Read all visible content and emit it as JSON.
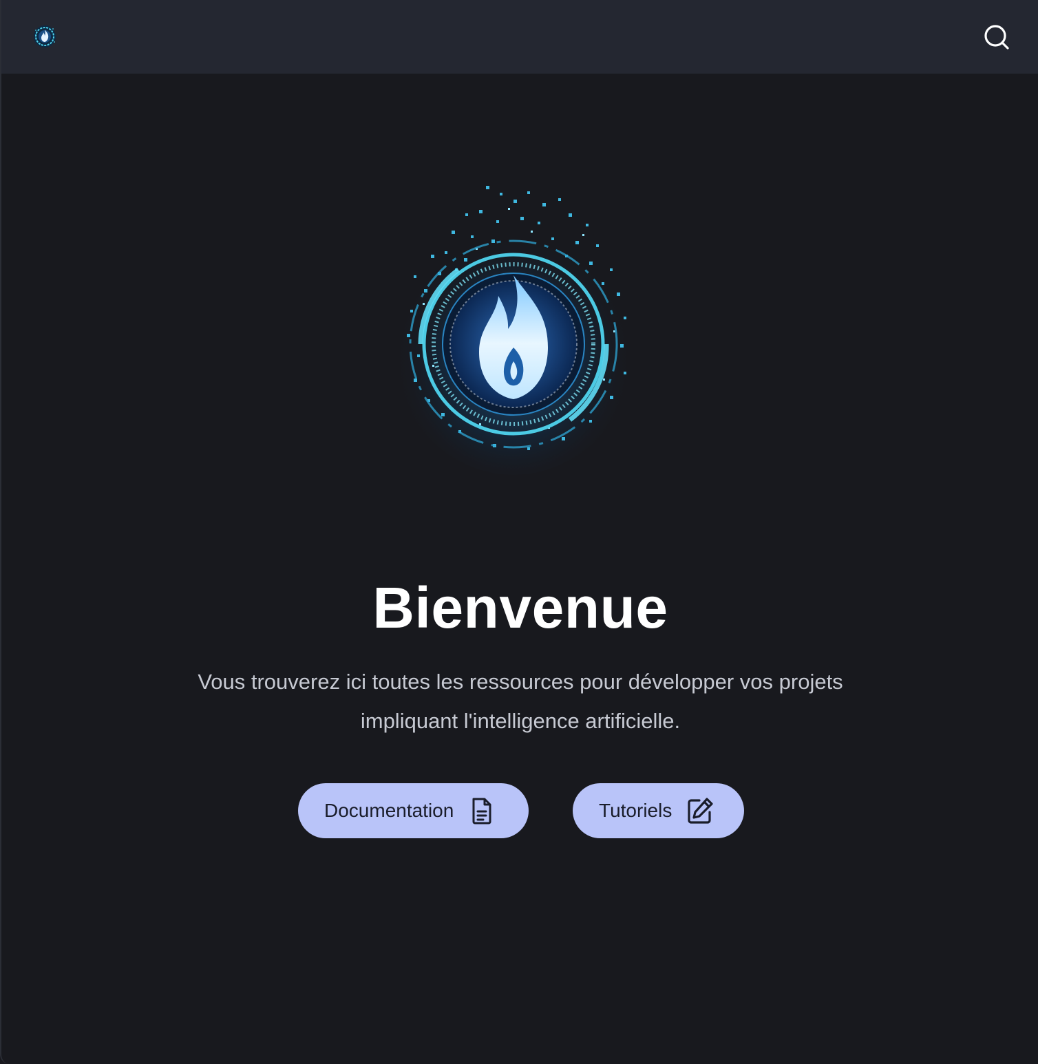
{
  "header": {
    "logo_icon": "flame-logo-icon",
    "search_icon": "search-icon"
  },
  "hero": {
    "logo_icon": "flame-circle-logo",
    "title": "Bienvenue",
    "tagline": "Vous trouverez ici toutes les ressources pour développer vos projets impliquant l'intelligence artificielle."
  },
  "actions": {
    "documentation_label": "Documentation",
    "documentation_icon": "document-icon",
    "tutorials_label": "Tutoriels",
    "tutorials_icon": "edit-icon"
  },
  "colors": {
    "background": "#18191e",
    "navbar": "#242731",
    "button": "#b9c4f9",
    "accent_cyan": "#4fd4ee"
  }
}
